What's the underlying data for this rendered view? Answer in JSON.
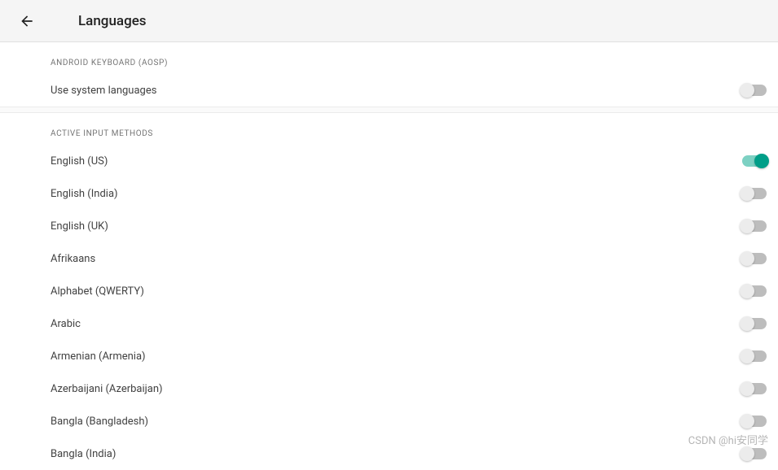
{
  "header": {
    "title": "Languages"
  },
  "sections": {
    "keyboard": {
      "header": "ANDROID KEYBOARD (AOSP)",
      "use_system_label": "Use system languages",
      "use_system_on": false
    },
    "methods": {
      "header": "ACTIVE INPUT METHODS",
      "items": [
        {
          "label": "English (US)",
          "on": true
        },
        {
          "label": "English (India)",
          "on": false
        },
        {
          "label": "English (UK)",
          "on": false
        },
        {
          "label": "Afrikaans",
          "on": false
        },
        {
          "label": "Alphabet (QWERTY)",
          "on": false
        },
        {
          "label": "Arabic",
          "on": false
        },
        {
          "label": "Armenian (Armenia)",
          "on": false
        },
        {
          "label": "Azerbaijani (Azerbaijan)",
          "on": false
        },
        {
          "label": "Bangla (Bangladesh)",
          "on": false
        },
        {
          "label": "Bangla (India)",
          "on": false
        }
      ]
    }
  },
  "watermark": "CSDN @hi安同学"
}
